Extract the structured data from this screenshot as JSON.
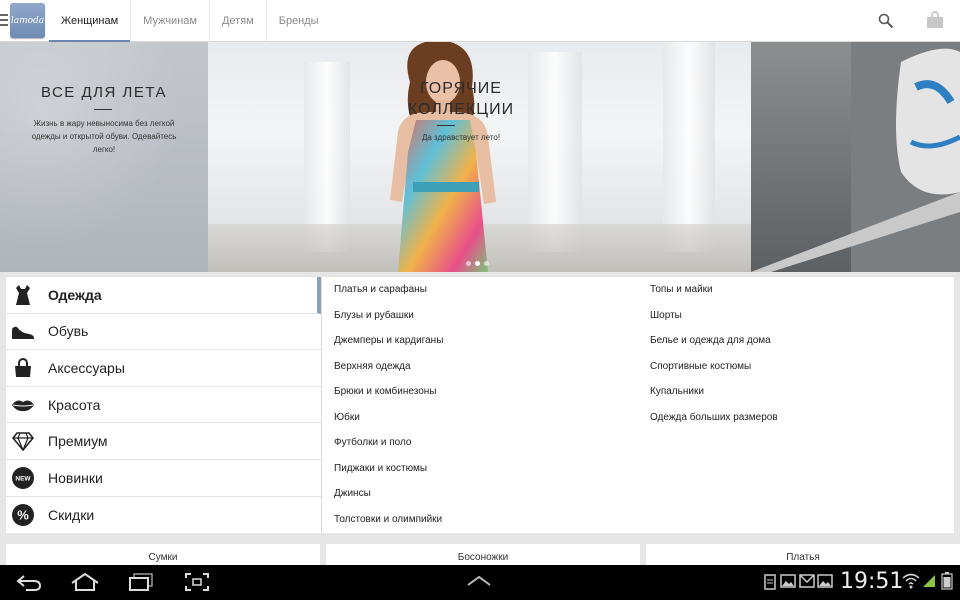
{
  "header": {
    "logo_text": "lamoda",
    "tabs": [
      {
        "label": "Женщинам",
        "active": true
      },
      {
        "label": "Мужчинам",
        "active": false
      },
      {
        "label": "Детям",
        "active": false
      },
      {
        "label": "Бренды",
        "active": false
      }
    ],
    "accent_color": "#6c86ad",
    "icons": [
      "menu-icon",
      "search-icon",
      "shopping-bag-icon"
    ]
  },
  "banner": {
    "left": {
      "title": "ВСЕ ДЛЯ ЛЕТА",
      "text": "Жизнь в жару невыносима без легкой одежды и открытой обуви. Одевайтесь легко!"
    },
    "center": {
      "title_line1": "ГОРЯЧИЕ",
      "title_line2": "КОЛЛЕКЦИИ",
      "text": "Да здравствует лето!"
    },
    "page_dots": 3,
    "active_dot": 1
  },
  "categories": [
    {
      "label": "Одежда",
      "icon": "dress-icon",
      "active": true
    },
    {
      "label": "Обувь",
      "icon": "shoe-icon",
      "active": false
    },
    {
      "label": "Аксессуары",
      "icon": "handbag-icon",
      "active": false
    },
    {
      "label": "Красота",
      "icon": "lips-icon",
      "active": false
    },
    {
      "label": "Премиум",
      "icon": "diamond-icon",
      "active": false
    },
    {
      "label": "Новинки",
      "icon": "new-badge-icon",
      "active": false
    },
    {
      "label": "Скидки",
      "icon": "percent-icon",
      "active": false
    }
  ],
  "subcategories": {
    "column1": [
      "Платья и сарафаны",
      "Блузы и рубашки",
      "Джемперы и кардиганы",
      "Верхняя одежда",
      "Брюки и комбинезоны",
      "Юбки",
      "Футболки и поло",
      "Пиджаки и костюмы",
      "Джинсы",
      "Толстовки и олимпийки"
    ],
    "column2": [
      "Топы и майки",
      "Шорты",
      "Белье и одежда для дома",
      "Спортивные костюмы",
      "Купальники",
      "Одежда больших размеров"
    ]
  },
  "tiles": [
    "Сумки",
    "Босоножки",
    "Платья"
  ],
  "system_bar": {
    "time": "19:51",
    "icons": [
      "back-icon",
      "home-icon",
      "recent-apps-icon",
      "screenshot-icon",
      "up-arrow-icon",
      "notification-icon",
      "image-icon",
      "mail-icon",
      "wifi-icon",
      "signal-icon",
      "battery-icon"
    ]
  }
}
